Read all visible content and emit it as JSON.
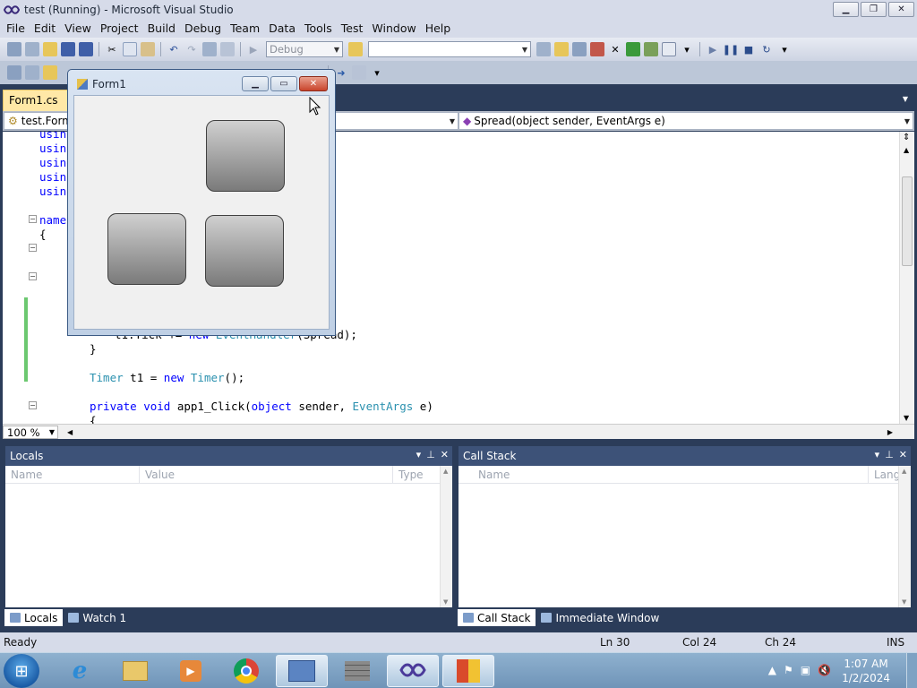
{
  "window": {
    "title": "test (Running) - Microsoft Visual Studio",
    "minimize": "▁",
    "restore": "❐",
    "close": "✕"
  },
  "menu": [
    "File",
    "Edit",
    "View",
    "Project",
    "Build",
    "Debug",
    "Team",
    "Data",
    "Tools",
    "Test",
    "Window",
    "Help"
  ],
  "toolbar": {
    "config_value": "Debug",
    "search_value": ""
  },
  "doc_tab": {
    "label": "Form1.cs",
    "pin": "✕"
  },
  "navbar": {
    "class_combo": "test.Form",
    "member_combo": "Spread(object sender, EventArgs e)"
  },
  "code": {
    "lines": [
      {
        "parts": [
          {
            "t": "using",
            "c": "kw"
          }
        ]
      },
      {
        "parts": [
          {
            "t": "using",
            "c": "kw"
          }
        ]
      },
      {
        "parts": [
          {
            "t": "using",
            "c": "kw"
          }
        ]
      },
      {
        "parts": [
          {
            "t": "using",
            "c": "kw"
          }
        ]
      },
      {
        "parts": [
          {
            "t": "using",
            "c": "kw"
          }
        ]
      },
      {
        "parts": [
          {
            "t": "names",
            "c": "kw"
          }
        ]
      },
      {
        "parts": [
          {
            "t": "{",
            "c": ""
          }
        ]
      },
      {
        "parts": [
          {
            "t": "t1.Tick += ",
            "c": ""
          },
          {
            "t": "new",
            "c": "kw"
          },
          {
            "t": " ",
            "c": ""
          },
          {
            "t": "EventHandler",
            "c": "ty"
          },
          {
            "t": "(Spread);",
            "c": ""
          }
        ]
      },
      {
        "parts": [
          {
            "t": "}",
            "c": ""
          }
        ]
      },
      {
        "parts": [
          {
            "t": "Timer",
            "c": "ty"
          },
          {
            "t": " t1 = ",
            "c": ""
          },
          {
            "t": "new",
            "c": "kw"
          },
          {
            "t": " ",
            "c": ""
          },
          {
            "t": "Timer",
            "c": "ty"
          },
          {
            "t": "();",
            "c": ""
          }
        ]
      },
      {
        "parts": [
          {
            "t": "private",
            "c": "kw"
          },
          {
            "t": " ",
            "c": ""
          },
          {
            "t": "void",
            "c": "kw"
          },
          {
            "t": " app1_Click(",
            "c": ""
          },
          {
            "t": "object",
            "c": "kw"
          },
          {
            "t": " sender, ",
            "c": ""
          },
          {
            "t": "EventArgs",
            "c": "ty"
          },
          {
            "t": " e)",
            "c": ""
          }
        ]
      },
      {
        "parts": [
          {
            "t": "{",
            "c": ""
          }
        ]
      }
    ]
  },
  "zoom": "100 %",
  "locals_panel": {
    "title": "Locals",
    "columns": [
      "Name",
      "Value",
      "Type"
    ]
  },
  "callstack_panel": {
    "title": "Call Stack",
    "columns": [
      "Name",
      "Lang"
    ]
  },
  "left_tabs": [
    "Locals",
    "Watch 1"
  ],
  "right_tabs": [
    "Call Stack",
    "Immediate Window"
  ],
  "status": {
    "ready": "Ready",
    "ln": "Ln 30",
    "col": "Col 24",
    "ch": "Ch 24",
    "ins": "INS"
  },
  "form1": {
    "title": "Form1"
  },
  "taskbar": {
    "time": "1:07 AM",
    "date": "1/2/2024"
  },
  "colors": {
    "accent": "#2b3c59",
    "panel_header": "#3d5278",
    "doc_tab": "#ffe8a6",
    "changed_line": "#6cc870"
  }
}
